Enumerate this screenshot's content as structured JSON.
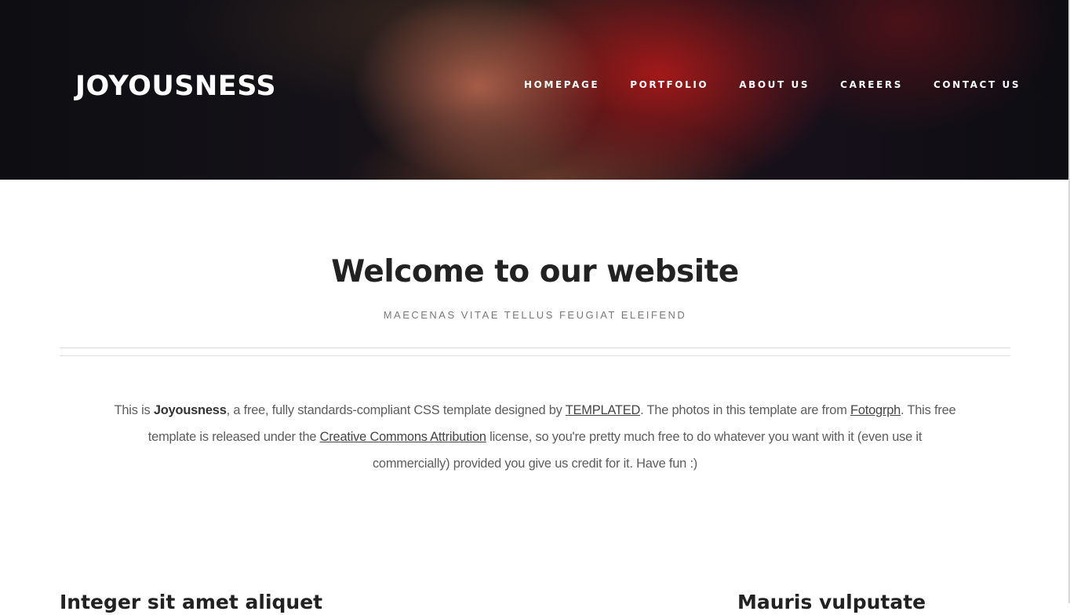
{
  "header": {
    "logo": "JOYOUSNESS",
    "nav": [
      {
        "label": "HOMEPAGE"
      },
      {
        "label": "PORTFOLIO"
      },
      {
        "label": "ABOUT US"
      },
      {
        "label": "CAREERS"
      },
      {
        "label": "CONTACT US"
      }
    ]
  },
  "welcome": {
    "title": "Welcome to our website",
    "subtitle": "MAECENAS VITAE TELLUS FEUGIAT ELEIFEND"
  },
  "intro": {
    "t1": "This is ",
    "brand": "Joyousness",
    "t2": ", a free, fully standards-compliant CSS template designed by ",
    "link_templated": "TEMPLATED",
    "t3": ". The photos in this template are from ",
    "link_fotogrph": "Fotogrph",
    "t4": ". This free template is released under the ",
    "link_license": "Creative Commons Attribution",
    "t5": " license, so you're pretty much free to do whatever you want with it (even use it commercially) provided you give us credit for it. Have fun :)"
  },
  "sections": {
    "left_heading": "Integer sit amet aliquet",
    "right_heading": "Mauris vulputate"
  },
  "colors": {
    "header_dark": "#0e0e12",
    "header_red": "#aa1919",
    "text_dark": "#222222",
    "text_muted": "#5d5d5d",
    "divider": "#dddddd"
  }
}
